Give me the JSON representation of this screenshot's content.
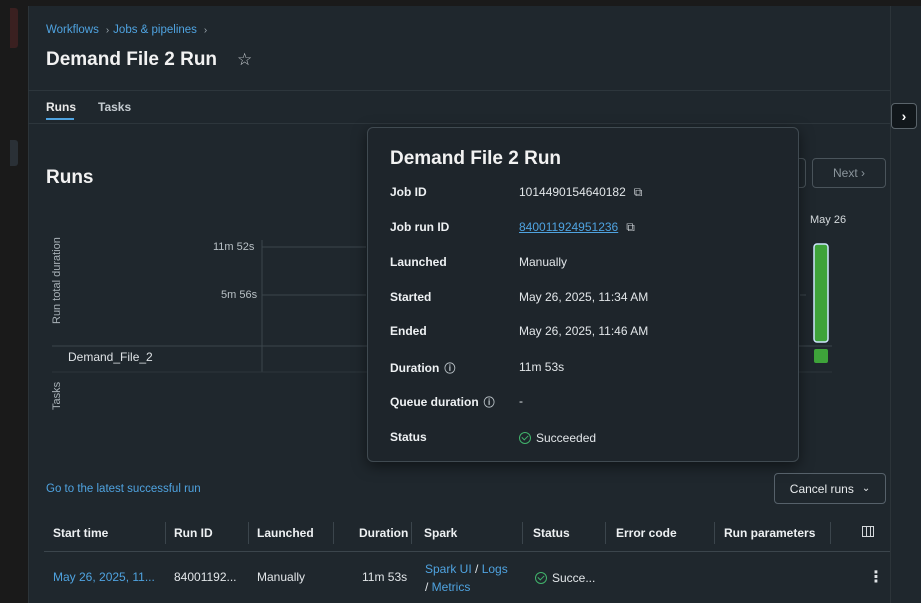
{
  "breadcrumb": [
    {
      "label": "Workflows"
    },
    {
      "label": "Jobs & pipelines"
    }
  ],
  "page": {
    "title": "Demand File 2 Run"
  },
  "tabs": [
    {
      "label": "Runs",
      "active": true
    },
    {
      "label": "Tasks",
      "active": false
    }
  ],
  "section": {
    "title": "Runs"
  },
  "pager": {
    "next_label": "Next ›"
  },
  "chart_data": {
    "type": "bar",
    "ylabel": "Run total duration",
    "y_ticks": [
      "11m 52s",
      "5m 56s"
    ],
    "categories": [
      "May 26"
    ],
    "values": [
      713
    ],
    "value_unit": "seconds",
    "tasks_label": "Tasks",
    "task_rows": [
      "Demand_File_2"
    ],
    "bar_color": "#3ea33a"
  },
  "tooltip": {
    "title": "Demand File 2 Run",
    "rows": [
      {
        "key": "Job ID",
        "value": "1014490154640182"
      },
      {
        "key": "Job run ID",
        "value": "840011924951236"
      },
      {
        "key": "Launched",
        "value": "Manually"
      },
      {
        "key": "Started",
        "value": "May 26, 2025, 11:34 AM"
      },
      {
        "key": "Ended",
        "value": "May 26, 2025, 11:46 AM"
      },
      {
        "key": "Duration",
        "value": "11m 53s"
      },
      {
        "key": "Queue duration",
        "value": "-"
      },
      {
        "key": "Status",
        "value": "Succeeded"
      }
    ]
  },
  "actions": {
    "latest_run_link": "Go to the latest successful run",
    "cancel_runs": "Cancel runs"
  },
  "table": {
    "columns": [
      "Start time",
      "Run ID",
      "Launched",
      "Duration",
      "Spark",
      "Status",
      "Error code",
      "Run parameters"
    ],
    "rows": [
      {
        "start_time": "May 26, 2025, 11...",
        "run_id": "84001192...",
        "launched": "Manually",
        "duration": "11m 53s",
        "spark_ui": "Spark UI",
        "spark_sep": " / ",
        "logs": "Logs",
        "metrics": "Metrics",
        "status": "Succe..."
      }
    ]
  },
  "colors": {
    "accent": "#4fa3e0",
    "success": "#41b36b",
    "bar": "#3ea33a"
  }
}
